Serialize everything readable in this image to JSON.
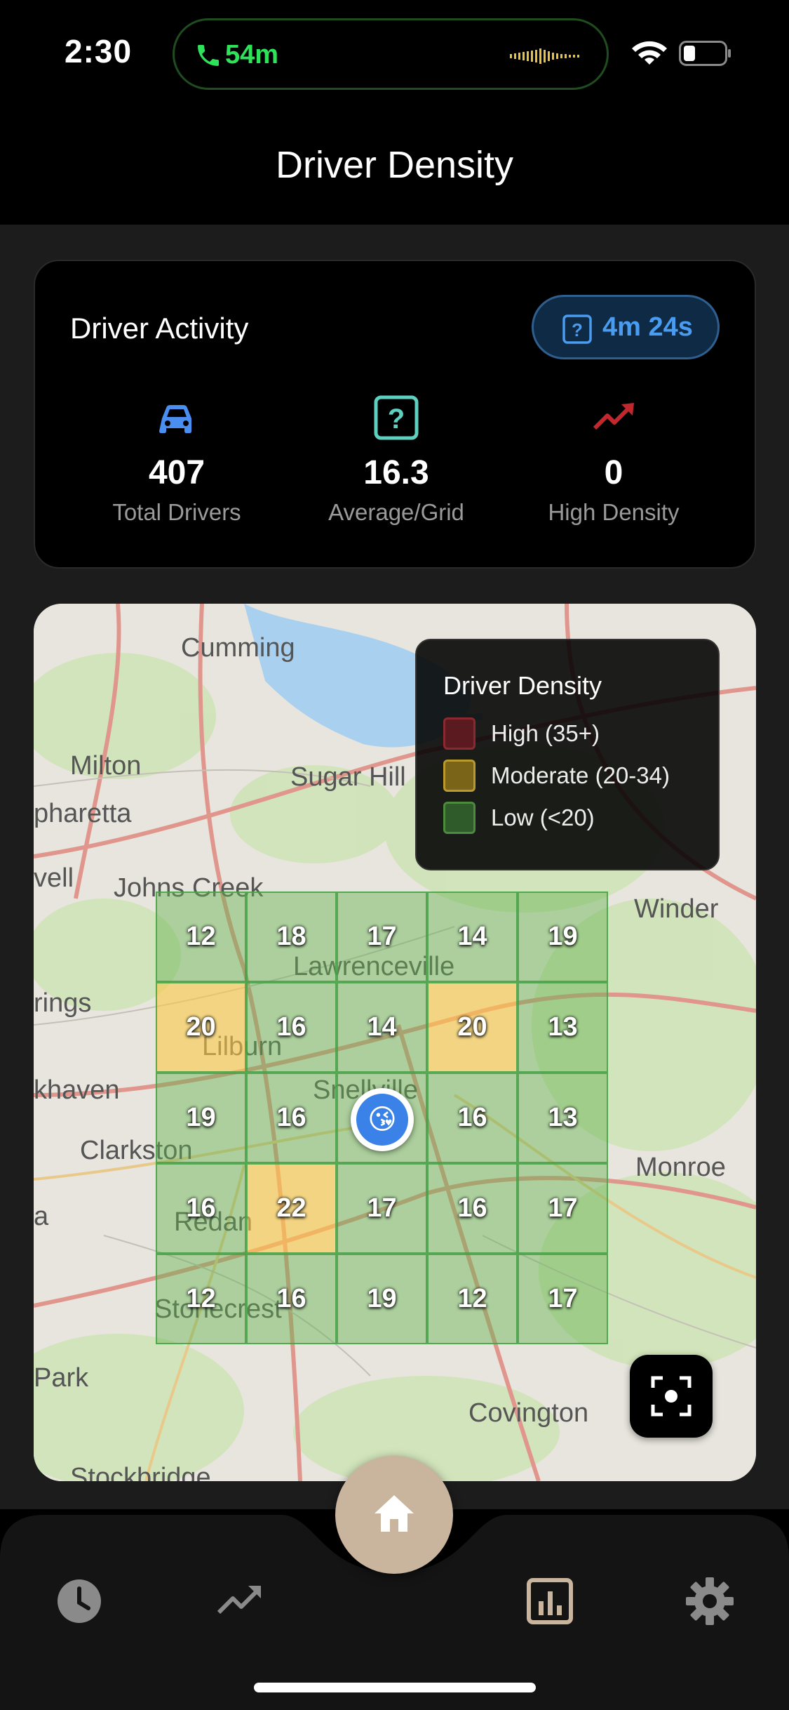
{
  "status_bar": {
    "time": "2:30",
    "call_duration": "54m"
  },
  "header": {
    "title": "Driver Density"
  },
  "activity": {
    "title": "Driver Activity",
    "timer": "4m 24s",
    "stats": [
      {
        "value": "407",
        "label": "Total Drivers",
        "icon": "car-icon"
      },
      {
        "value": "16.3",
        "label": "Average/Grid",
        "icon": "help-box-icon"
      },
      {
        "value": "0",
        "label": "High Density",
        "icon": "trending-up-icon"
      }
    ]
  },
  "map": {
    "places": [
      "Cumming",
      "Milton",
      "Sugar Hill",
      "pharetta",
      "vell",
      "Johns Creek",
      "Winder",
      "Lawrenceville",
      "rings",
      "Lilburn",
      "khaven",
      "Snellville",
      "Clarkston",
      "Monroe",
      "a",
      "Redan",
      "Stonecrest",
      "Park",
      "Covington",
      "Stockbridge"
    ],
    "legend": {
      "title": "Driver Density",
      "items": [
        {
          "label": "High (35+)",
          "color": "#5a1a20"
        },
        {
          "label": "Moderate (20-34)",
          "color": "#7a6418"
        },
        {
          "label": "Low (<20)",
          "color": "#2f5a2a"
        }
      ]
    },
    "grid": [
      [
        "12",
        "18",
        "17",
        "14",
        "19"
      ],
      [
        "20",
        "16",
        "14",
        "20",
        "13"
      ],
      [
        "19",
        "16",
        "",
        "16",
        "13"
      ],
      [
        "16",
        "22",
        "17",
        "16",
        "17"
      ],
      [
        "12",
        "16",
        "19",
        "12",
        "17"
      ]
    ],
    "grid_levels": [
      [
        "low",
        "low",
        "low",
        "low",
        "low"
      ],
      [
        "mod",
        "low",
        "low",
        "mod",
        "low"
      ],
      [
        "low",
        "low",
        "low",
        "low",
        "low"
      ],
      [
        "low",
        "mod",
        "low",
        "low",
        "low"
      ],
      [
        "low",
        "low",
        "low",
        "low",
        "low"
      ]
    ],
    "user_marker": "😘"
  },
  "nav": {
    "items": [
      "history-icon",
      "trending-up-icon",
      "home-icon",
      "bar-chart-icon",
      "settings-icon"
    ]
  }
}
